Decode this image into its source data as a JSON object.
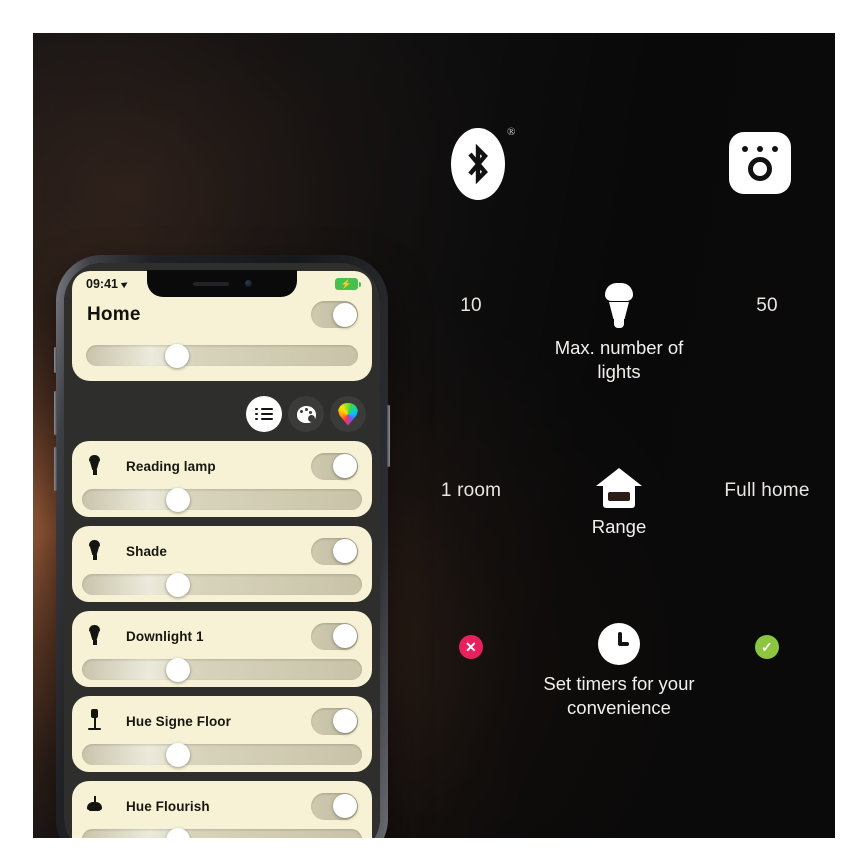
{
  "background": {
    "panel_dark": "#131314",
    "glow_warm": "#c47446"
  },
  "features": {
    "bluetooth_icon": "bluetooth-icon",
    "bluetooth_trademark": "®",
    "bridge_icon": "hue-bridge-icon",
    "rows": [
      {
        "icon": "light-bulb-icon",
        "left_value": "10",
        "label": "Max. number\nof lights",
        "right_value": "50"
      },
      {
        "icon": "house-icon",
        "left_value": "1 room",
        "label": "Range",
        "right_value": "Full home"
      },
      {
        "icon": "clock-icon",
        "left_value": "✕",
        "label": "Set timers\nfor your\nconvenience",
        "right_value": "✓"
      }
    ],
    "chip_colors": {
      "negative": "#e8205e",
      "positive": "#8cc63f"
    }
  },
  "phone": {
    "status_bar": {
      "time": "09:41",
      "location_icon": "location-arrow-icon",
      "battery_icon": "battery-charging-icon",
      "battery_bolt": "⚡",
      "battery_color": "#46c14e"
    },
    "header": {
      "title": "Home",
      "toggle_state": "on",
      "brightness_percent": 29
    },
    "tabs": [
      {
        "name": "list",
        "icon": "list-icon",
        "active": true
      },
      {
        "name": "scenes",
        "icon": "palette-icon",
        "active": false
      },
      {
        "name": "colors",
        "icon": "color-pin-icon",
        "active": false
      }
    ],
    "card_color": "#f7f2d6",
    "lights": [
      {
        "name": "Reading lamp",
        "icon": "spot-bulb-icon",
        "toggle_state": "on",
        "brightness_percent": 30
      },
      {
        "name": "Shade",
        "icon": "spot-bulb-icon",
        "toggle_state": "on",
        "brightness_percent": 30
      },
      {
        "name": "Downlight 1",
        "icon": "spot-bulb-icon",
        "toggle_state": "on",
        "brightness_percent": 30
      },
      {
        "name": "Hue Signe Floor",
        "icon": "floor-lamp-icon",
        "toggle_state": "on",
        "brightness_percent": 30
      },
      {
        "name": "Hue Flourish",
        "icon": "pendant-lamp-icon",
        "toggle_state": "on",
        "brightness_percent": 30
      }
    ]
  }
}
